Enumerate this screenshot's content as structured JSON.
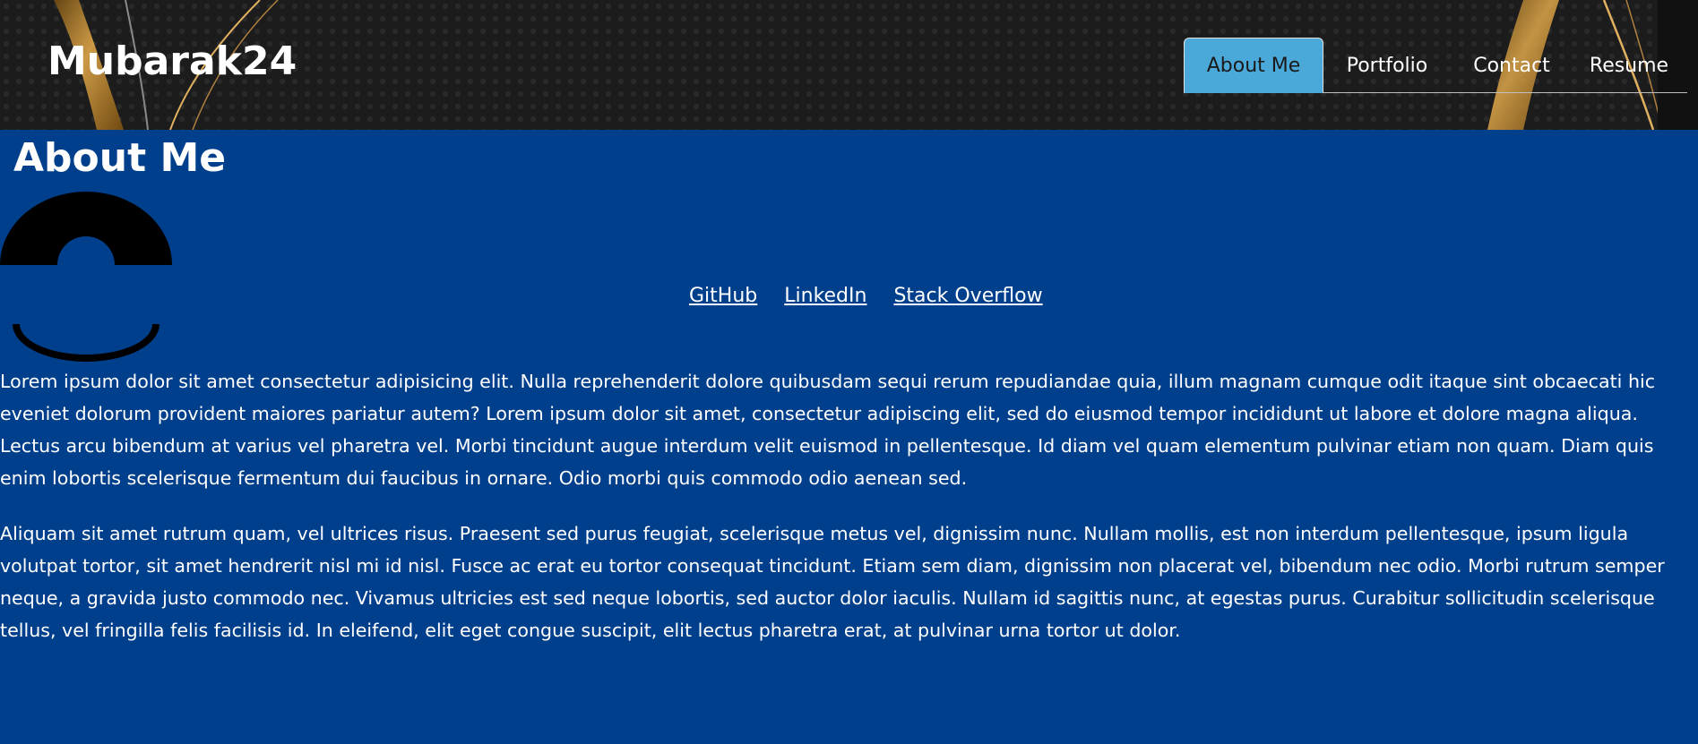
{
  "header": {
    "site_title": "Mubarak24",
    "nav": [
      {
        "label": "About Me",
        "active": true
      },
      {
        "label": "Portfolio",
        "active": false
      },
      {
        "label": "Contact",
        "active": false
      },
      {
        "label": "Resume",
        "active": false
      }
    ]
  },
  "main": {
    "heading": "About Me",
    "avatar_icon": "avatar-icon",
    "links": [
      "GitHub",
      "LinkedIn",
      "Stack Overflow"
    ],
    "paragraphs": [
      [
        "Lorem ipsum dolor sit amet consectetur adipisicing elit. Nulla reprehenderit dolore quibusdam sequi rerum repudiandae quia, illum magnam cumque odit itaque sint obcaecati hic",
        "eveniet dolorum provident maiores pariatur autem? Lorem ipsum dolor sit amet, consectetur adipiscing elit, sed do eiusmod tempor incididunt ut labore et dolore magna aliqua.",
        "Lectus arcu bibendum at varius vel pharetra vel. Morbi tincidunt augue interdum velit euismod in pellentesque. Id diam vel quam elementum pulvinar etiam non quam. Diam quis",
        "enim lobortis scelerisque fermentum dui faucibus in ornare. Odio morbi quis commodo odio aenean sed."
      ],
      [
        "Aliquam sit amet rutrum quam, vel ultrices risus. Praesent sed purus feugiat, scelerisque metus vel, dignissim nunc. Nullam mollis, est non interdum pellentesque, ipsum ligula",
        "volutpat tortor, sit amet hendrerit nisl mi id nisl. Fusce ac erat eu tortor consequat tincidunt. Etiam sem diam, dignissim non placerat vel, bibendum nec odio. Morbi rutrum semper",
        "neque, a gravida justo commodo nec. Vivamus ultricies est sed neque lobortis, sed auctor dolor iaculis. Nullam id sagittis nunc, at egestas purus. Curabitur sollicitudin scelerisque",
        "tellus, vel fringilla felis facilisis id. In eleifend, elit eget congue suscipit, elit lectus pharetra erat, at pulvinar urna tortor ut dolor."
      ]
    ]
  },
  "colors": {
    "page_background": "#003f8c",
    "active_tab": "#4aa9d8",
    "header_background": "#1a1a1a",
    "gold_accent": "#d9a441"
  }
}
